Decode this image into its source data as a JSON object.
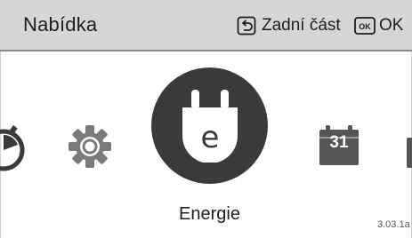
{
  "header": {
    "title": "Nabídka",
    "back": {
      "icon": "back-arrow-icon",
      "label": "Zadní část"
    },
    "ok": {
      "icon": "ok-key-icon",
      "badge": "OK",
      "label": "OK"
    }
  },
  "menu": {
    "items": [
      {
        "id": "timer",
        "icon": "stopwatch-icon",
        "visible": "partial-left"
      },
      {
        "id": "settings",
        "icon": "gear-icon"
      },
      {
        "id": "energy",
        "icon": "power-plug-icon",
        "letter": "e",
        "label": "Energie",
        "selected": true
      },
      {
        "id": "calendar",
        "icon": "calendar-icon",
        "value": "31"
      },
      {
        "id": "next",
        "icon": "unknown-icon",
        "visible": "partial-right"
      }
    ],
    "selected_label": "Energie"
  },
  "version": "3.03.1a",
  "colors": {
    "header_bg": "#d6d6d6",
    "icon_dark": "#3a3a3a",
    "icon_gray": "#7a7a7a",
    "text": "#1e1e1e"
  }
}
